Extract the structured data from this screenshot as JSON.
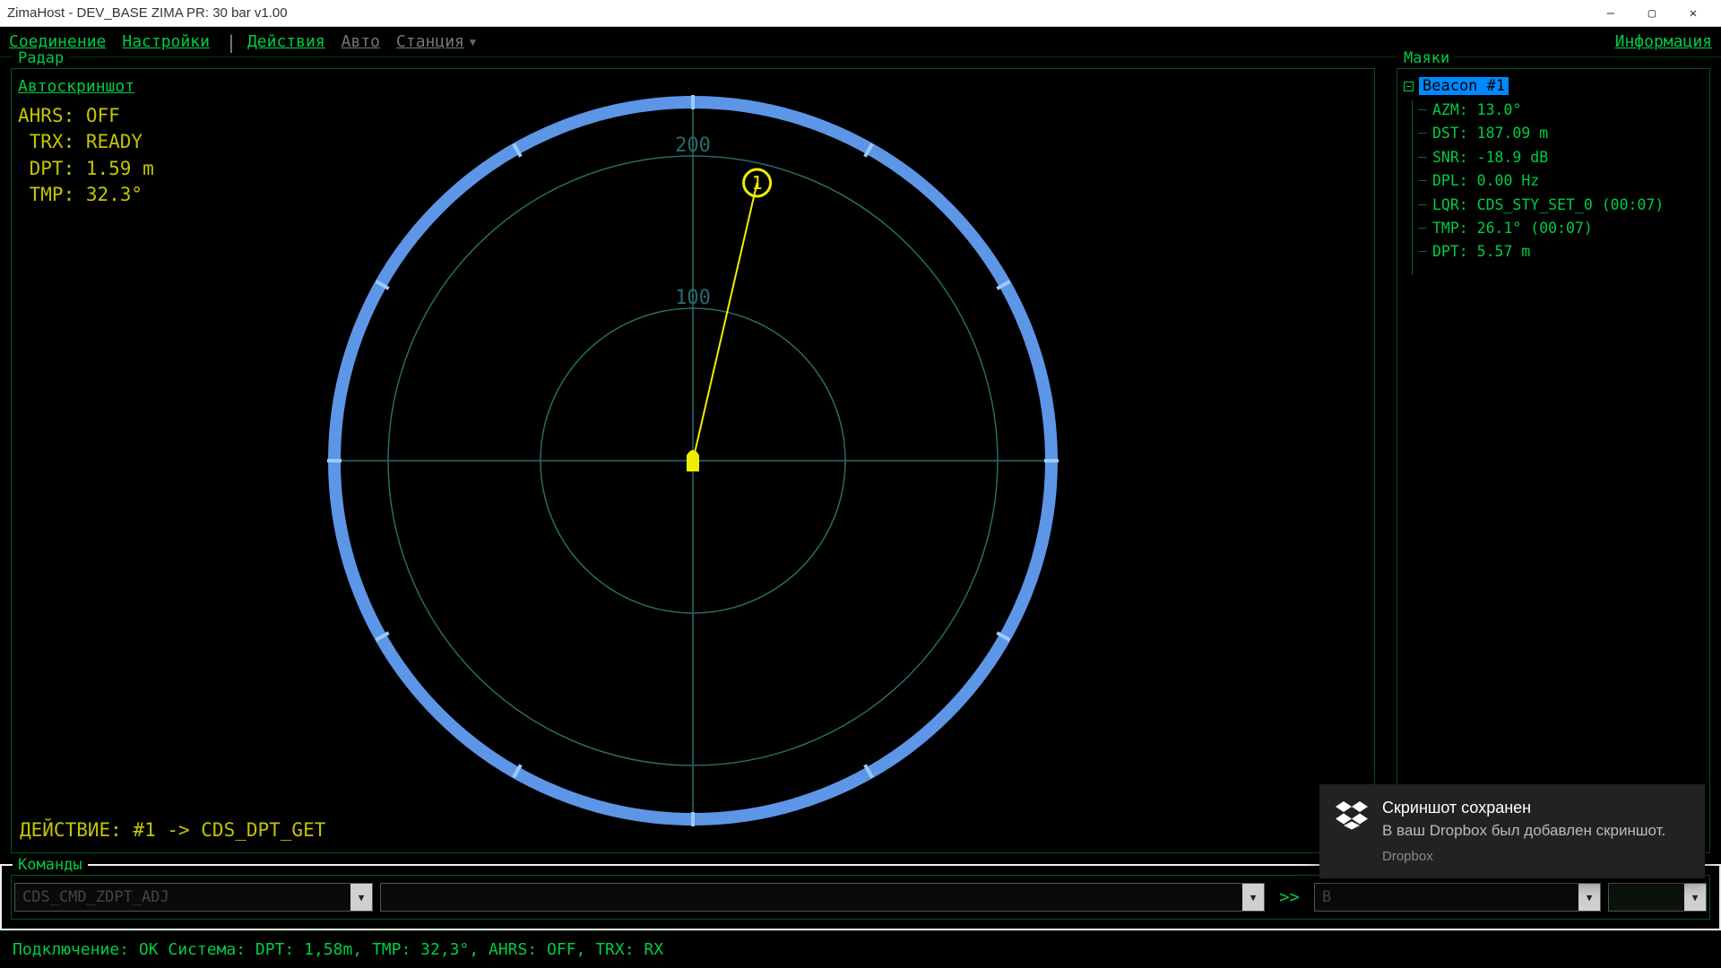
{
  "titlebar": {
    "title": "ZimaHost - DEV_BASE ZIMA PR: 30 bar v1.00"
  },
  "menu": {
    "connection": "Соединение",
    "settings": "Настройки",
    "actions": "Действия",
    "auto": "Авто",
    "station": "Станция",
    "info": "Информация"
  },
  "radar": {
    "label": "Радар",
    "autoscreenshot": "Автоскриншот",
    "status": {
      "l1": "AHRS: OFF",
      "l2": " TRX: READY",
      "l3": " DPT: 1.59 m",
      "l4": " TMP: 32.3°"
    },
    "rings": {
      "r1": "100",
      "r2": "200"
    },
    "action": "ДЕЙСТВИЕ: #1 -> CDS_DPT_GET",
    "beacon_marker": {
      "id": "1",
      "azimuth_deg": 13.0,
      "distance_m": 187.09
    }
  },
  "beacons": {
    "label": "Маяки",
    "node": "Beacon #1",
    "attrs": {
      "azm": "AZM: 13.0°",
      "dst": "DST: 187.09 m",
      "snr": "SNR: -18.9 dB",
      "dpl": "DPL: 0.00 Hz",
      "lqr": "LQR: CDS_STY_SET_0 (00:07)",
      "tmp": "TMP: 26.1° (00:07)",
      "dpt": "DPT: 5.57 m"
    }
  },
  "commands": {
    "label": "Команды",
    "cmd_select": "CDS_CMD_ZDPT_ADJ",
    "arg_field": "",
    "arrow": ">>",
    "target_field": "B"
  },
  "status": {
    "text": "Подключение: ОК   Система:  DPT: 1,58m, TMP: 32,3°, AHRS: OFF, TRX: RX"
  },
  "toast": {
    "title": "Скриншот сохранен",
    "body": "В ваш Dropbox был добавлен скриншот.",
    "app": "Dropbox"
  },
  "chart_data": {
    "type": "scatter",
    "title": "Радар",
    "rings_m": [
      100,
      200
    ],
    "axis_ticks_deg": [
      0,
      30,
      60,
      90,
      120,
      150,
      180,
      210,
      240,
      270,
      300,
      330
    ],
    "points": [
      {
        "id": "1",
        "azimuth_deg": 13.0,
        "distance_m": 187.09
      }
    ]
  }
}
